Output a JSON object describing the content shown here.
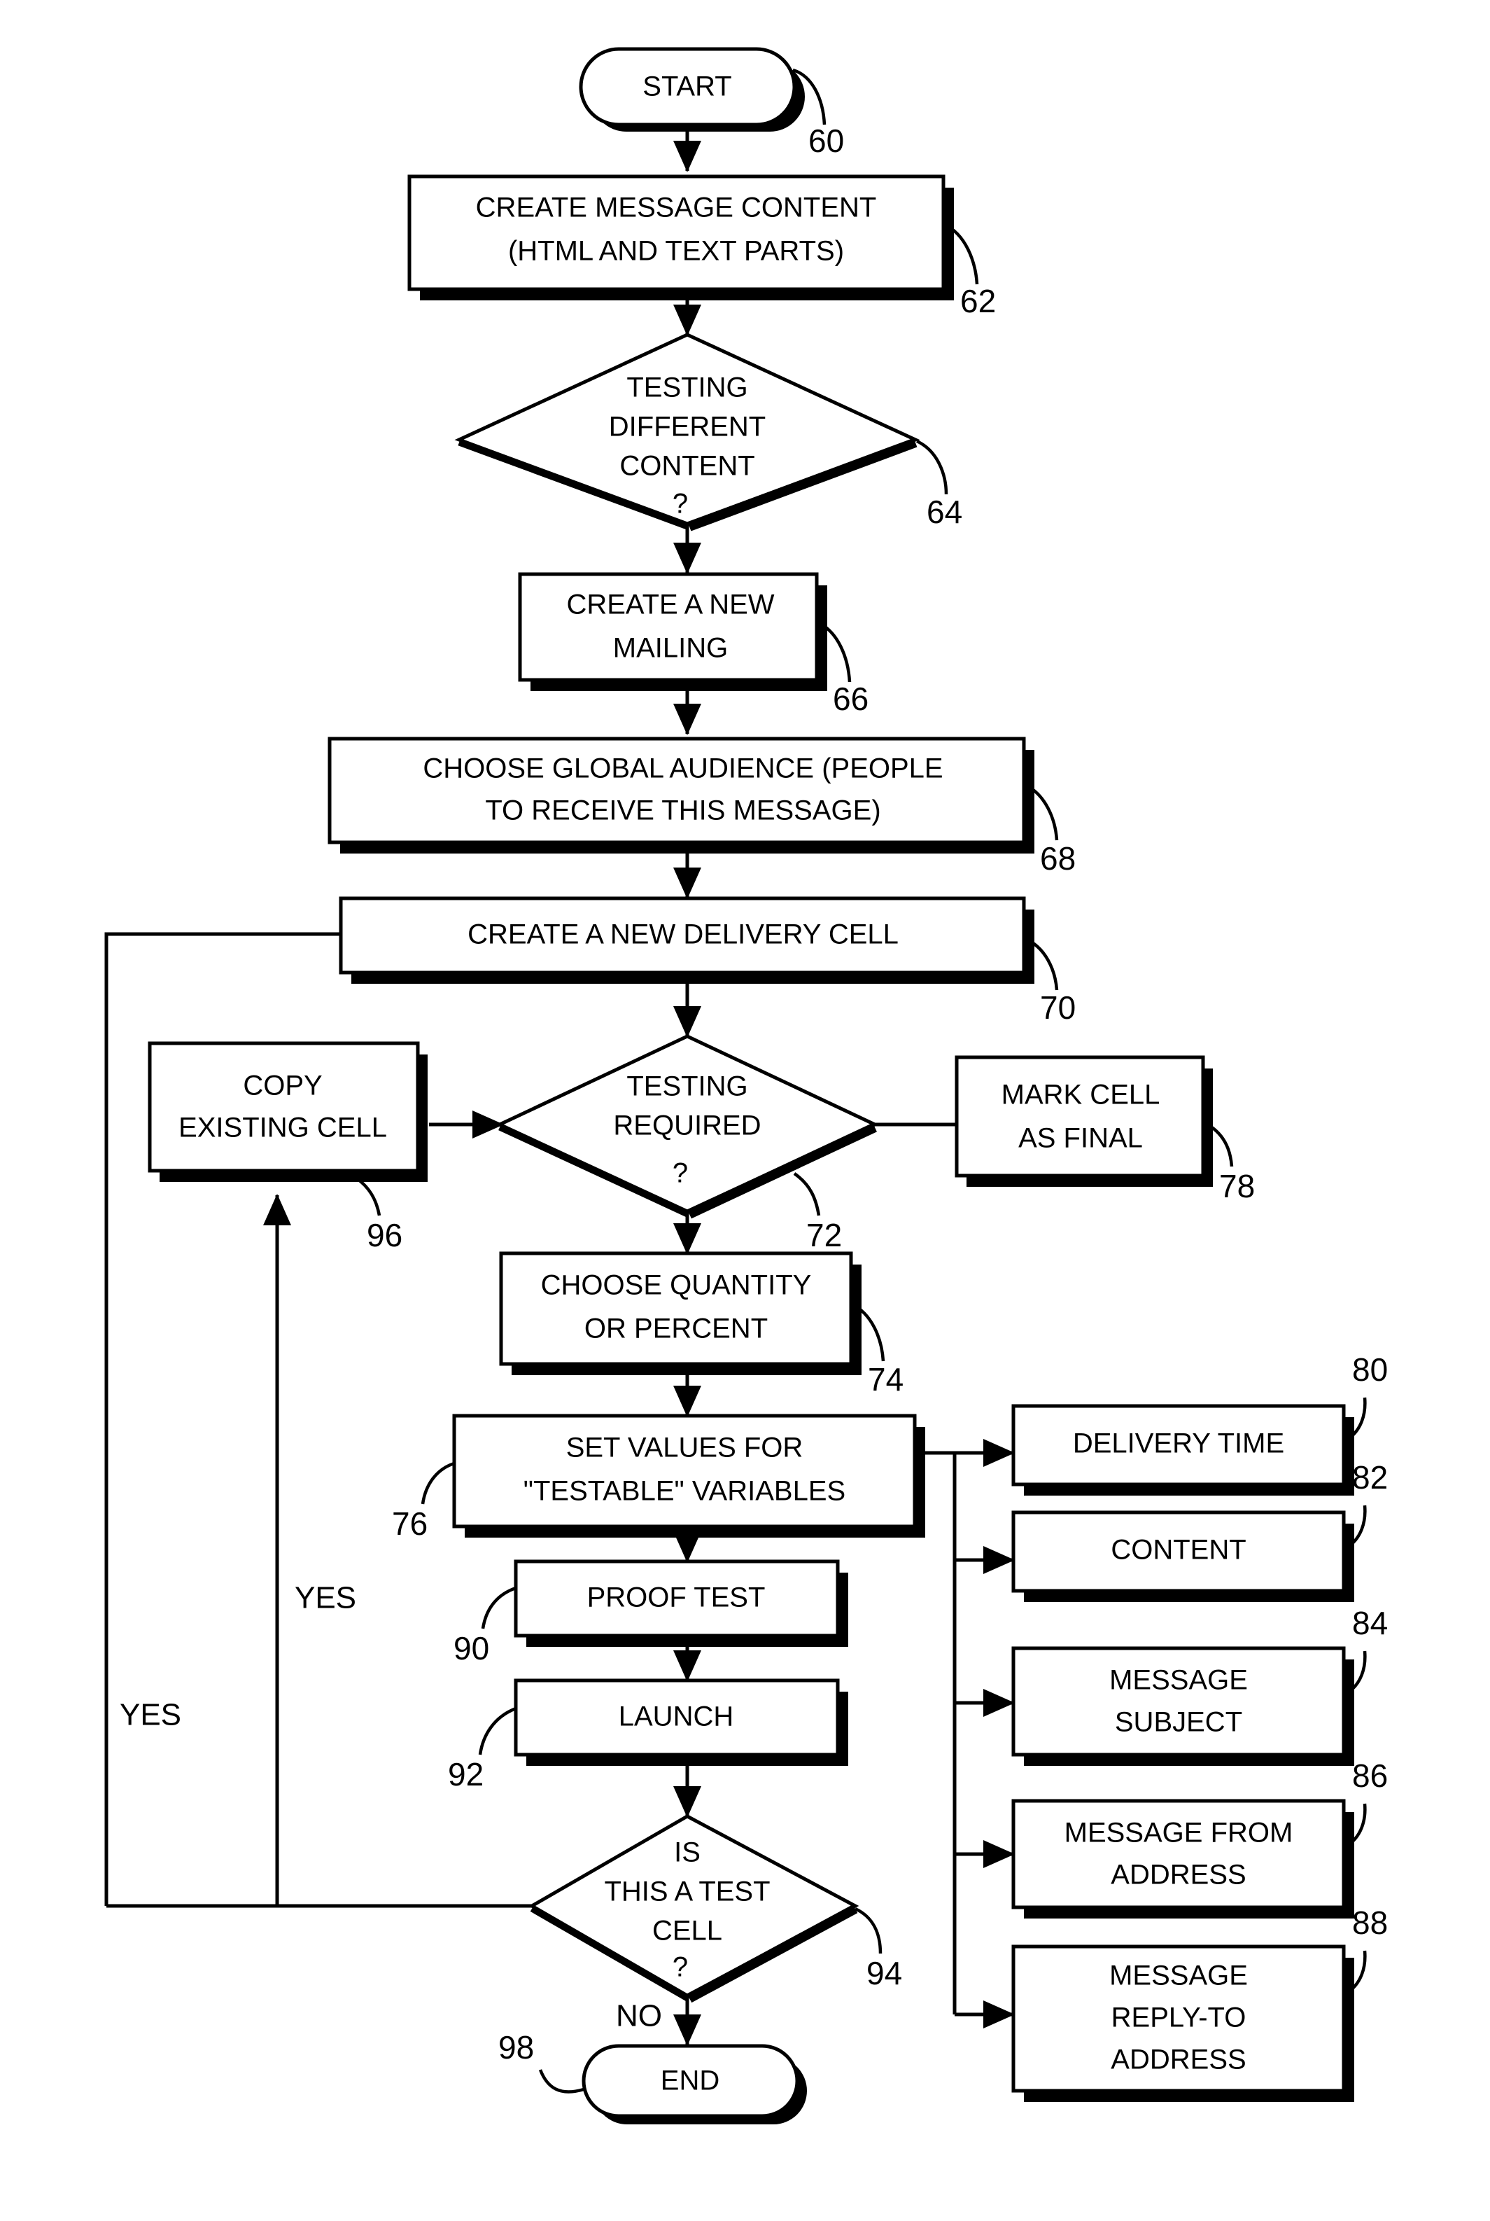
{
  "diagram": {
    "type": "flowchart",
    "title": "",
    "orientation": "top-to-bottom",
    "background_color": "#ffffff",
    "line_color": "#000000",
    "text_color": "#000000"
  },
  "nodes": {
    "start": {
      "label": "START",
      "shape": "terminator",
      "ref": "60"
    },
    "create_message_content": {
      "line1": "CREATE MESSAGE CONTENT",
      "line2": "(HTML AND TEXT PARTS)",
      "shape": "process",
      "ref": "62"
    },
    "testing_different_content": {
      "line1": "TESTING",
      "line2": "DIFFERENT",
      "line3": "CONTENT",
      "line4": "?",
      "shape": "decision",
      "ref": "64"
    },
    "create_new_mailing": {
      "line1": "CREATE A NEW",
      "line2": "MAILING",
      "shape": "process",
      "ref": "66"
    },
    "choose_global_audience": {
      "line1": "CHOOSE GLOBAL AUDIENCE (PEOPLE",
      "line2": "TO RECEIVE THIS MESSAGE)",
      "shape": "process",
      "ref": "68"
    },
    "create_delivery_cell": {
      "line1": "CREATE A NEW DELIVERY CELL",
      "shape": "process",
      "ref": "70"
    },
    "copy_existing_cell": {
      "line1": "COPY",
      "line2": "EXISTING CELL",
      "shape": "process",
      "ref": "96"
    },
    "testing_required": {
      "line1": "TESTING",
      "line2": "REQUIRED",
      "line3": "?",
      "shape": "decision",
      "ref": "72"
    },
    "mark_cell_final": {
      "line1": "MARK CELL",
      "line2": "AS FINAL",
      "shape": "process",
      "ref": "78"
    },
    "choose_quantity": {
      "line1": "CHOOSE QUANTITY",
      "line2": "OR PERCENT",
      "shape": "process",
      "ref": "74"
    },
    "set_values": {
      "line1": "SET VALUES FOR",
      "line2": "\"TESTABLE\" VARIABLES",
      "shape": "process",
      "ref": "76"
    },
    "proof_test": {
      "line1": "PROOF TEST",
      "shape": "process",
      "ref": "90"
    },
    "launch": {
      "line1": "LAUNCH",
      "shape": "process",
      "ref": "92"
    },
    "is_test_cell": {
      "line1": "IS",
      "line2": "THIS A TEST",
      "line3": "CELL",
      "line4": "?",
      "shape": "decision",
      "ref": "94"
    },
    "end": {
      "label": "END",
      "shape": "terminator",
      "ref": "98"
    },
    "delivery_time": {
      "line1": "DELIVERY TIME",
      "shape": "process",
      "ref": "80"
    },
    "content": {
      "line1": "CONTENT",
      "shape": "process",
      "ref": "82"
    },
    "message_subject": {
      "line1": "MESSAGE",
      "line2": "SUBJECT",
      "shape": "process",
      "ref": "84"
    },
    "message_from_address": {
      "line1": "MESSAGE FROM",
      "line2": "ADDRESS",
      "shape": "process",
      "ref": "86"
    },
    "message_reply_to_address": {
      "line1": "MESSAGE",
      "line2": "REPLY-TO",
      "line3": "ADDRESS",
      "shape": "process",
      "ref": "88"
    }
  },
  "edge_labels": {
    "yes_outer": "YES",
    "yes_inner": "YES",
    "no_end": "NO"
  },
  "reference_numerals": [
    "60",
    "62",
    "64",
    "66",
    "68",
    "70",
    "72",
    "74",
    "76",
    "78",
    "80",
    "82",
    "84",
    "86",
    "88",
    "90",
    "92",
    "94",
    "96",
    "98"
  ]
}
